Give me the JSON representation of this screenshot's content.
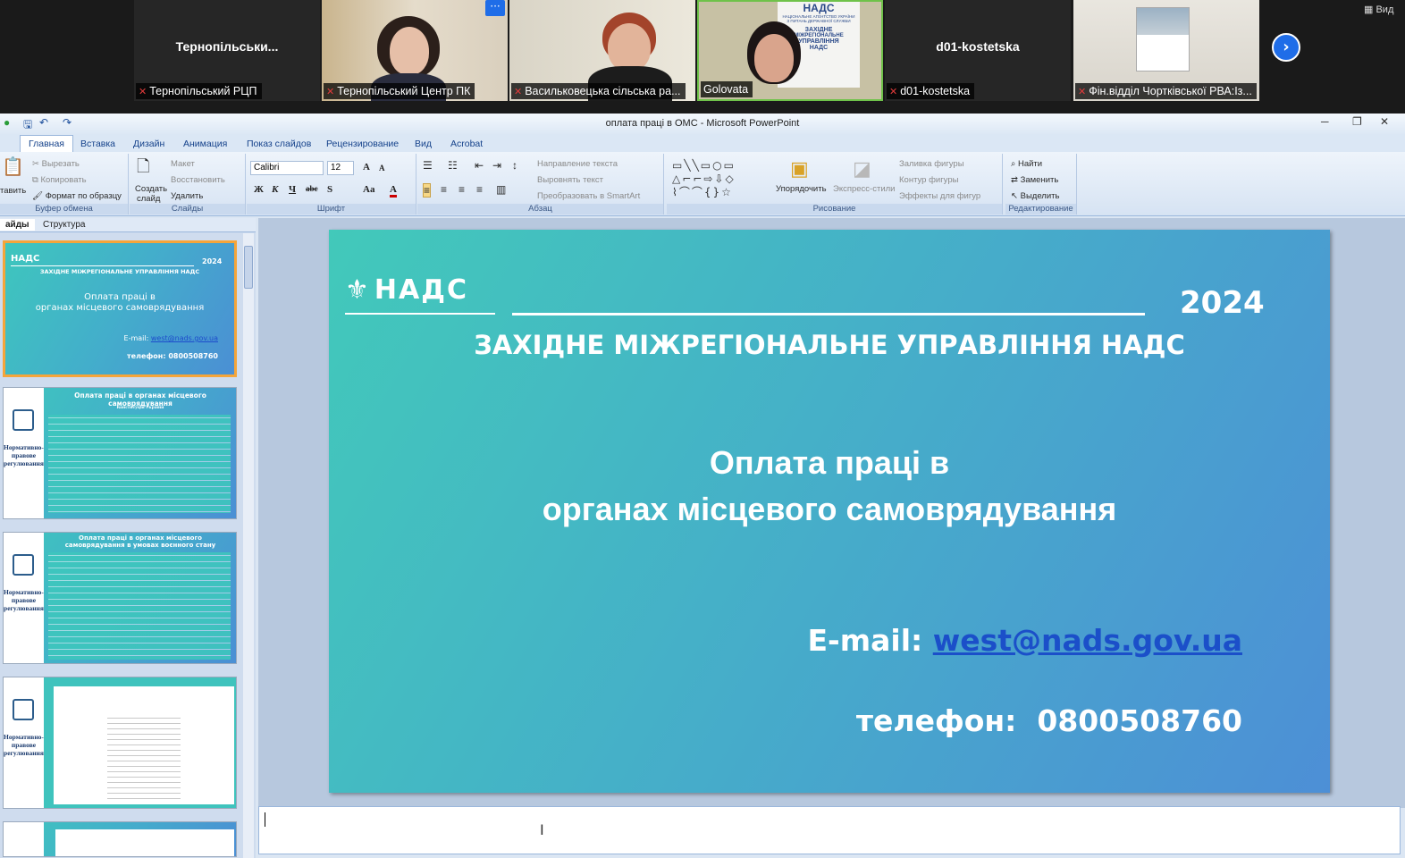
{
  "zoom": {
    "view_label": "Вид",
    "tiles": [
      {
        "big_name": "Тернопільськи...",
        "caption": "Тернопільський РЦП",
        "muted": true
      },
      {
        "big_name": "",
        "caption": "Тернопільський Центр ПК",
        "muted": true,
        "more": "···"
      },
      {
        "big_name": "",
        "caption": "Васильковецька сільська ра...",
        "muted": true
      },
      {
        "big_name": "",
        "caption": "Golovata",
        "muted": false,
        "banner": [
          "НАДС",
          "НАЦІОНАЛЬНЕ АГЕНТСТВО УКРАЇНИ",
          "З ПИТАНЬ ДЕРЖАВНОЇ СЛУЖБИ",
          "ЗАХІДНЕ",
          "МІЖРЕГІОНАЛЬНЕ",
          "УПРАВЛІННЯ",
          "НАДС"
        ]
      },
      {
        "big_name": "d01-kostetska",
        "caption": "d01-kostetska",
        "muted": true
      },
      {
        "big_name": "",
        "caption": "Фін.відділ Чортківської РВА:Із...",
        "muted": true
      }
    ]
  },
  "app": {
    "title": "оплата праці в ОМС - Microsoft PowerPoint",
    "tabs": [
      "Главная",
      "Вставка",
      "Дизайн",
      "Анимация",
      "Показ слайдов",
      "Рецензирование",
      "Вид",
      "Acrobat"
    ],
    "active_tab": "Главная",
    "ribbon": {
      "clipboard": {
        "paste": "тавить",
        "cut": "Вырезать",
        "copy": "Копировать",
        "format": "Формат по образцу",
        "label": "Буфер обмена"
      },
      "slides": {
        "new": "Создать",
        "new2": "слайд",
        "layout": "Макет",
        "reset": "Восстановить",
        "delete": "Удалить",
        "label": "Слайды"
      },
      "font": {
        "name": "Calibri",
        "size": "12",
        "label": "Шрифт"
      },
      "paragraph": {
        "direction": "Направление текста",
        "align": "Выровнять текст",
        "smartart": "Преобразовать в SmartArt",
        "label": "Абзац"
      },
      "drawing": {
        "arrange": "Упорядочить",
        "quick": "Экспресс-стили",
        "fill": "Заливка фигуры",
        "outline": "Контур фигуры",
        "effects": "Эффекты для фигур",
        "label": "Рисование"
      },
      "editing": {
        "find": "Найти",
        "replace": "Заменить",
        "select": "Выделить",
        "label": "Редактирование"
      }
    },
    "panel_tabs": [
      "айды",
      "Структура"
    ],
    "thumbs": {
      "t1": {
        "logo": "НАДС",
        "year": "2024",
        "sub": "ЗАХІДНЕ МІЖРЕГІОНАЛЬНЕ УПРАВЛІННЯ НАДС",
        "title1": "Оплата праці в",
        "title2": "органах місцевого самоврядування",
        "email_label": "E-mail:",
        "email": "west@nads.gov.ua",
        "phone_label": "телефон:",
        "phone": "0800508760"
      },
      "t2": {
        "title": "Оплата праці в органах місцевого самоврядування",
        "sub": "Конституція України",
        "side": "Нормативно-правове регулювання"
      },
      "t3": {
        "title": "Оплата праці в органах місцевого самоврядування в умовах воєнного стану",
        "side": "Нормативно-правове регулювання"
      },
      "t4": {
        "side": "Нормативно-правове регулювання"
      }
    },
    "slide": {
      "logo": "НАДС",
      "year": "2024",
      "subtitle": "ЗАХІДНЕ МІЖРЕГІОНАЛЬНЕ УПРАВЛІННЯ НАДС",
      "title_line1": "Оплата праці в",
      "title_line2": "органах місцевого самоврядування",
      "email_label": "E-mail:",
      "email": "west@nads.gov.ua",
      "phone_label": "телефон:",
      "phone": "0800508760"
    }
  },
  "colors": {
    "accent": "#1f6de8",
    "slide_start": "#42c9ba",
    "slide_end": "#4d8fd6",
    "selected_thumb": "#f5a53a"
  }
}
